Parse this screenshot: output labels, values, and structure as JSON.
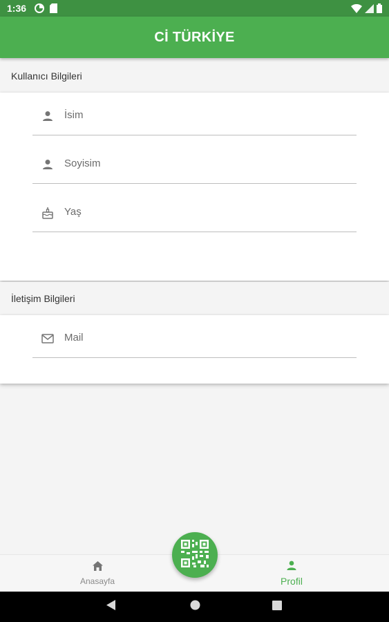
{
  "status_bar": {
    "time": "1:36",
    "icons": [
      "data-saver-icon",
      "sim-card-icon",
      "wifi-icon",
      "signal-icon",
      "battery-icon"
    ]
  },
  "app_bar": {
    "title": "Cİ TÜRKİYE"
  },
  "sections": {
    "user_info": {
      "header": "Kullanıcı Bilgileri",
      "fields": [
        {
          "placeholder": "İsim",
          "value": "",
          "icon": "person-icon"
        },
        {
          "placeholder": "Soyisim",
          "value": "",
          "icon": "person-icon"
        },
        {
          "placeholder": "Yaş",
          "value": "",
          "icon": "cake-icon"
        }
      ]
    },
    "contact_info": {
      "header": "İletişim Bilgileri",
      "fields": [
        {
          "placeholder": "Mail",
          "value": "",
          "icon": "mail-icon"
        }
      ]
    }
  },
  "bottom_nav": {
    "items": [
      {
        "label": "Anasayfa",
        "icon": "home-icon",
        "active": false
      },
      {
        "label": "Profil",
        "icon": "person-icon",
        "active": true
      }
    ],
    "fab_icon": "qr-code-icon"
  },
  "colors": {
    "primary": "#4caf50",
    "status_bar": "#3e9142",
    "background": "#f4f4f4",
    "inactive": "#8a8a8a"
  }
}
